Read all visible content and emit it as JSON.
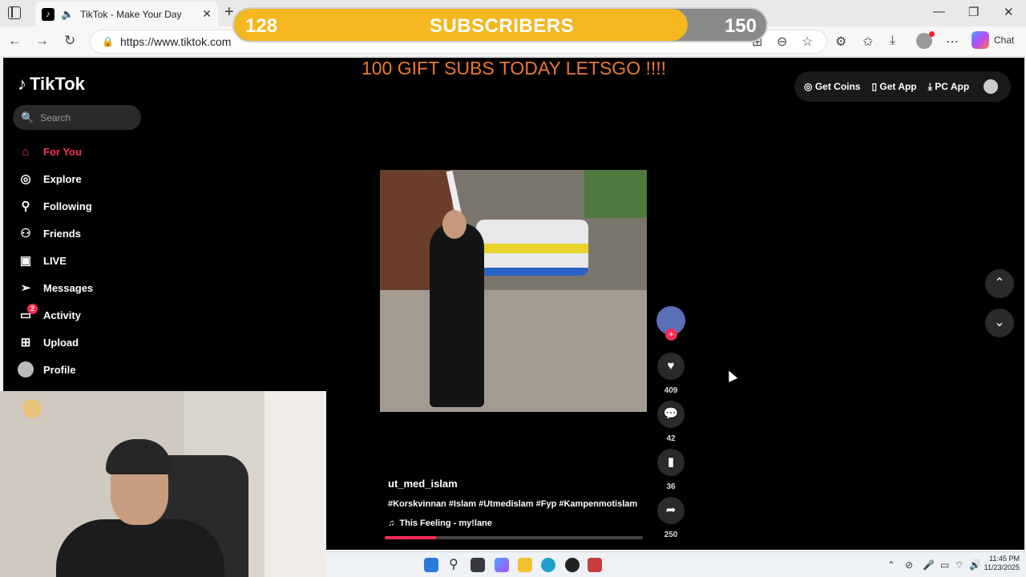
{
  "browser": {
    "tab_title": "TikTok - Make Your Day",
    "url": "https://www.tiktok.com",
    "copilot_label": "Chat"
  },
  "subscriber_goal": {
    "current": "128",
    "label": "SUBSCRIBERS",
    "goal": "150",
    "progress_fraction": 0.853
  },
  "banner": "100 GIFT SUBS TODAY LETSGO !!!!",
  "tiktok": {
    "logo_text": "TikTok",
    "search_placeholder": "Search",
    "nav": [
      {
        "label": "For You",
        "icon": "home-icon",
        "active": true
      },
      {
        "label": "Explore",
        "icon": "compass-icon"
      },
      {
        "label": "Following",
        "icon": "person-plus-icon"
      },
      {
        "label": "Friends",
        "icon": "friends-icon"
      },
      {
        "label": "LIVE",
        "icon": "live-icon"
      },
      {
        "label": "Messages",
        "icon": "paper-plane-icon"
      },
      {
        "label": "Activity",
        "icon": "activity-icon",
        "badge": "2"
      },
      {
        "label": "Upload",
        "icon": "plus-square-icon"
      },
      {
        "label": "Profile",
        "icon": "avatar"
      }
    ],
    "top_actions": {
      "get_coins": "Get Coins",
      "get_app": "Get App",
      "pc_app": "PC App"
    },
    "video": {
      "author": "ut_med_islam",
      "hashtags": "#Korskvinnan #Islam #Utmedislam #Fyp #Kampenmotislam",
      "music": "This Feeling - my!lane",
      "likes": "409",
      "comments": "42",
      "saves": "36",
      "shares": "250",
      "progress_fraction": 0.2
    }
  },
  "system": {
    "time": "11:45 PM",
    "date": "11/23/2025"
  },
  "colors": {
    "accent": "#fe2c55",
    "banner": "#ee7733",
    "sub_fill": "#f5b71f"
  }
}
